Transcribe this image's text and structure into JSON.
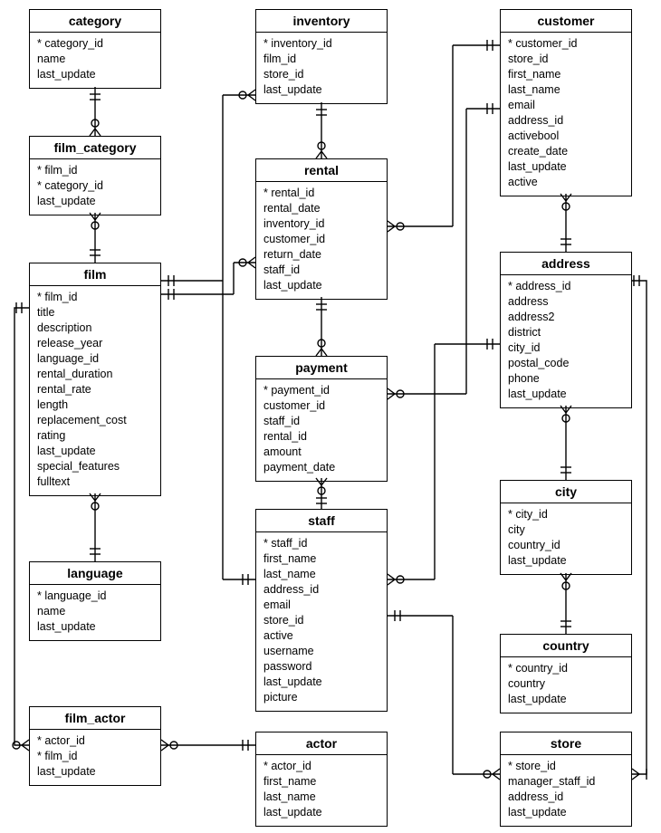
{
  "entities": {
    "category": {
      "title": "category",
      "fields": [
        "* category_id",
        "name",
        "last_update"
      ]
    },
    "film_category": {
      "title": "film_category",
      "fields": [
        "* film_id",
        "* category_id",
        "last_update"
      ]
    },
    "film": {
      "title": "film",
      "fields": [
        "* film_id",
        "title",
        "description",
        "release_year",
        "language_id",
        "rental_duration",
        "rental_rate",
        "length",
        "replacement_cost",
        "rating",
        "last_update",
        "special_features",
        "fulltext"
      ]
    },
    "language": {
      "title": "language",
      "fields": [
        "* language_id",
        "name",
        "last_update"
      ]
    },
    "film_actor": {
      "title": "film_actor",
      "fields": [
        "* actor_id",
        "* film_id",
        "last_update"
      ]
    },
    "inventory": {
      "title": "inventory",
      "fields": [
        "* inventory_id",
        "film_id",
        "store_id",
        "last_update"
      ]
    },
    "rental": {
      "title": "rental",
      "fields": [
        "* rental_id",
        "rental_date",
        "inventory_id",
        "customer_id",
        "return_date",
        "staff_id",
        "last_update"
      ]
    },
    "payment": {
      "title": "payment",
      "fields": [
        "* payment_id",
        "customer_id",
        "staff_id",
        "rental_id",
        "amount",
        "payment_date"
      ]
    },
    "staff": {
      "title": "staff",
      "fields": [
        "* staff_id",
        "first_name",
        "last_name",
        "address_id",
        "email",
        "store_id",
        "active",
        "username",
        "password",
        "last_update",
        "picture"
      ]
    },
    "actor": {
      "title": "actor",
      "fields": [
        "* actor_id",
        "first_name",
        "last_name",
        "last_update"
      ]
    },
    "customer": {
      "title": "customer",
      "fields": [
        "* customer_id",
        "store_id",
        "first_name",
        "last_name",
        "email",
        "address_id",
        "activebool",
        "create_date",
        "last_update",
        "active"
      ]
    },
    "address": {
      "title": "address",
      "fields": [
        "* address_id",
        "address",
        "address2",
        "district",
        "city_id",
        "postal_code",
        "phone",
        "last_update"
      ]
    },
    "city": {
      "title": "city",
      "fields": [
        "* city_id",
        "city",
        "country_id",
        "last_update"
      ]
    },
    "country": {
      "title": "country",
      "fields": [
        "* country_id",
        "country",
        "last_update"
      ]
    },
    "store": {
      "title": "store",
      "fields": [
        "* store_id",
        "manager_staff_id",
        "address_id",
        "last_update"
      ]
    }
  },
  "chart_data": {
    "type": "er-diagram",
    "relationships": [
      {
        "from": "category",
        "to": "film_category",
        "notation": "one-to-many"
      },
      {
        "from": "film_category",
        "to": "film",
        "notation": "many-to-one"
      },
      {
        "from": "film",
        "to": "language",
        "notation": "many-to-one"
      },
      {
        "from": "film",
        "to": "film_actor",
        "notation": "one-to-many"
      },
      {
        "from": "film_actor",
        "to": "actor",
        "notation": "many-to-one"
      },
      {
        "from": "film",
        "to": "inventory",
        "notation": "one-to-many"
      },
      {
        "from": "inventory",
        "to": "rental",
        "notation": "one-to-many"
      },
      {
        "from": "rental",
        "to": "payment",
        "notation": "one-to-many"
      },
      {
        "from": "rental",
        "to": "staff",
        "notation": "many-to-one"
      },
      {
        "from": "payment",
        "to": "staff",
        "notation": "many-to-one"
      },
      {
        "from": "rental",
        "to": "customer",
        "notation": "many-to-one"
      },
      {
        "from": "payment",
        "to": "customer",
        "notation": "many-to-one"
      },
      {
        "from": "customer",
        "to": "address",
        "notation": "many-to-one"
      },
      {
        "from": "staff",
        "to": "address",
        "notation": "many-to-one"
      },
      {
        "from": "store",
        "to": "address",
        "notation": "many-to-one"
      },
      {
        "from": "store",
        "to": "staff",
        "notation": "one-to-one"
      },
      {
        "from": "address",
        "to": "city",
        "notation": "many-to-one"
      },
      {
        "from": "city",
        "to": "country",
        "notation": "many-to-one"
      }
    ]
  }
}
